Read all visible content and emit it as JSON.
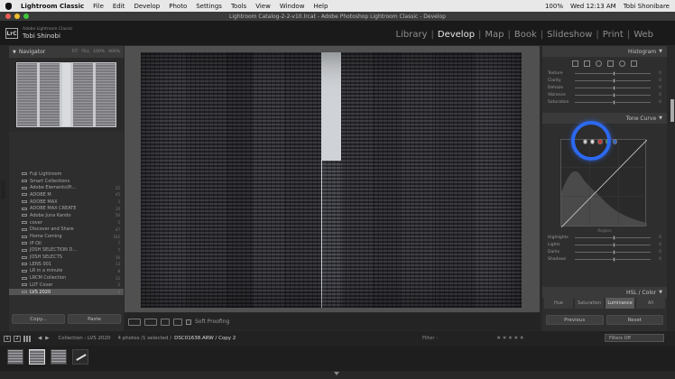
{
  "menubar": {
    "app_name": "Lightroom Classic",
    "items": [
      "File",
      "Edit",
      "Develop",
      "Photo",
      "Settings",
      "Tools",
      "View",
      "Window",
      "Help"
    ],
    "battery": "100%",
    "clock": "Wed 12:13 AM",
    "user": "Tobi Shonibare"
  },
  "window": {
    "title": "Lightroom Catalog-2-2-v10.lrcat - Adobe Photoshop Lightroom Classic - Develop"
  },
  "identity": {
    "badge": "LrC",
    "catalog_label": "Adobe Lightroom Classic",
    "user_name": "Tobi Shinobi"
  },
  "modules": {
    "items": [
      "Library",
      "Develop",
      "Map",
      "Book",
      "Slideshow",
      "Print",
      "Web"
    ],
    "active": "Develop"
  },
  "left_panel": {
    "navigator_title": "Navigator",
    "zoom_levels": [
      "FIT",
      "FILL",
      "100%",
      "400%"
    ],
    "collections": [
      {
        "name": "Fuji Lightroom",
        "count": ""
      },
      {
        "name": "Smart Collections",
        "count": ""
      },
      {
        "name": "Adobe Elements\\Pi...",
        "count": "35"
      },
      {
        "name": "ADOBE M",
        "count": "45"
      },
      {
        "name": "ADOBE MAX",
        "count": "3"
      },
      {
        "name": "ADOBE MAX CREATE",
        "count": "10"
      },
      {
        "name": "Adobe Juna Kando",
        "count": "56"
      },
      {
        "name": "cover",
        "count": "5"
      },
      {
        "name": "Discover and Share",
        "count": "47"
      },
      {
        "name": "Home Coming",
        "count": "162"
      },
      {
        "name": "IP Oil",
        "count": "7"
      },
      {
        "name": "JOSH SELECTION D...",
        "count": "7"
      },
      {
        "name": "JOSH SELECTS",
        "count": "16"
      },
      {
        "name": "LENS 001",
        "count": "13"
      },
      {
        "name": "LR in a minute",
        "count": "8"
      },
      {
        "name": "LRCM Collection",
        "count": "12"
      },
      {
        "name": "LUT Cover",
        "count": "2"
      },
      {
        "name": "LVS 2020",
        "count": "4"
      }
    ],
    "copy_label": "Copy...",
    "paste_label": "Paste"
  },
  "toolbar": {
    "soft_proofing_label": "Soft Proofing"
  },
  "right_panel": {
    "histogram_title": "Histogram",
    "basic_sliders": [
      {
        "name": "Texture",
        "value": "0"
      },
      {
        "name": "Clarity",
        "value": "0"
      },
      {
        "name": "Dehaze",
        "value": "0"
      },
      {
        "name": "Vibrance",
        "value": "0"
      },
      {
        "name": "Saturation",
        "value": "0"
      }
    ],
    "tone_curve_title": "Tone Curve",
    "region_label": "Region",
    "region_sliders": [
      {
        "name": "Highlights",
        "value": "0"
      },
      {
        "name": "Lights",
        "value": "0"
      },
      {
        "name": "Darks",
        "value": "0"
      },
      {
        "name": "Shadows",
        "value": "0"
      }
    ],
    "hsl_title": "HSL / Color",
    "hsl_tabs": [
      "Hue",
      "Saturation",
      "Luminance",
      "All"
    ],
    "hsl_active": "Luminance",
    "previous_label": "Previous",
    "reset_label": "Reset",
    "highlight_color": "#2d69f0"
  },
  "filmstrip": {
    "page_badges": [
      "1",
      "2"
    ],
    "source": "Collection : LVS 2020",
    "count_text": "4 photos /1 selected /",
    "filename": "DSC01638.ARW / Copy 2",
    "filter_label": "Filter :",
    "filter_value": "Filters Off"
  }
}
